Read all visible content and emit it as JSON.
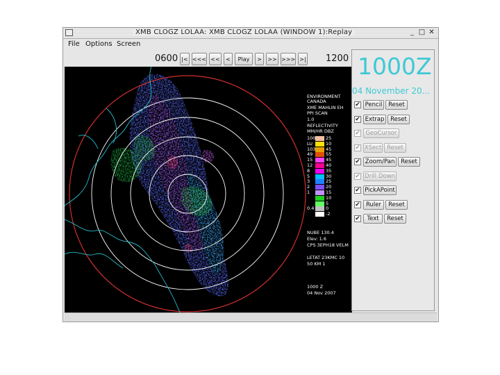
{
  "window": {
    "title": "XMB CLOGZ LOLAA: XMB CLOGZ LOLAA (WINDOW 1):Replay",
    "min": "_",
    "max": "□",
    "close": "✕"
  },
  "menu": [
    "File",
    "Options",
    "Screen"
  ],
  "toolbar": {
    "start_time": "0600",
    "end_time": "1200",
    "buttons": [
      "|<",
      "<<<",
      "<<",
      "<",
      "Play",
      ">",
      ">>",
      ">>>",
      ">|"
    ]
  },
  "side_panel": {
    "time": "1000Z",
    "date": "04 November 20...",
    "tools": [
      {
        "label": "Pencil",
        "reset": "Reset",
        "checked": true,
        "enabled": true
      },
      {
        "label": "Extrap",
        "reset": "Reset",
        "checked": true,
        "enabled": true
      },
      {
        "label": "GeoCursor",
        "reset": "",
        "checked": true,
        "enabled": false
      },
      {
        "label": "XSect",
        "reset": "Reset",
        "checked": true,
        "enabled": false
      },
      {
        "label": "Zoom/Pan",
        "reset": "Reset",
        "checked": true,
        "enabled": true
      },
      {
        "label": "Drill Down",
        "reset": "",
        "checked": true,
        "enabled": false
      },
      {
        "label": "PickAPoint",
        "reset": "",
        "checked": true,
        "enabled": true
      },
      {
        "label": "Ruler",
        "reset": "Reset",
        "checked": true,
        "enabled": true
      },
      {
        "label": "Text",
        "reset": "Reset",
        "checked": true,
        "enabled": true
      }
    ]
  },
  "radar_overlay": {
    "header_lines": [
      "ENVIRONMENT",
      "CANADA",
      "XME MAHLIN EH",
      "PPI SCAN",
      "1.0",
      "REFLECTIVITY",
      "MM/HR DBZ"
    ],
    "legend_labels": [
      "25",
      "10",
      "45",
      "55",
      "45",
      "40",
      "35",
      "30",
      "25",
      "20",
      "15",
      "10",
      "5",
      "0",
      "-2"
    ],
    "legend_left": [
      "100",
      "LU",
      "103",
      "49",
      "15",
      "12",
      "8",
      "5",
      "3",
      "2",
      "1",
      "",
      "",
      "0.4",
      ""
    ],
    "legend_colors": [
      "#f2c0a0",
      "#ffe000",
      "#e8a000",
      "#e05000",
      "#ff40ff",
      "#ff0090",
      "#f000f0",
      "#00c0ff",
      "#2080ff",
      "#8050ff",
      "#c090ff",
      "#20d020",
      "#60ff60",
      "#c0c0c0",
      "#ffffff"
    ],
    "range_info": [
      "NUBE 130.4",
      "Elev: 1.6",
      "CPS 3EPH18 VELM"
    ],
    "lat_info": [
      "LETAT 23KMC 10",
      "50 KM         1"
    ],
    "footer_time": "1000 Z",
    "footer_date": "04 Nov 2007"
  }
}
